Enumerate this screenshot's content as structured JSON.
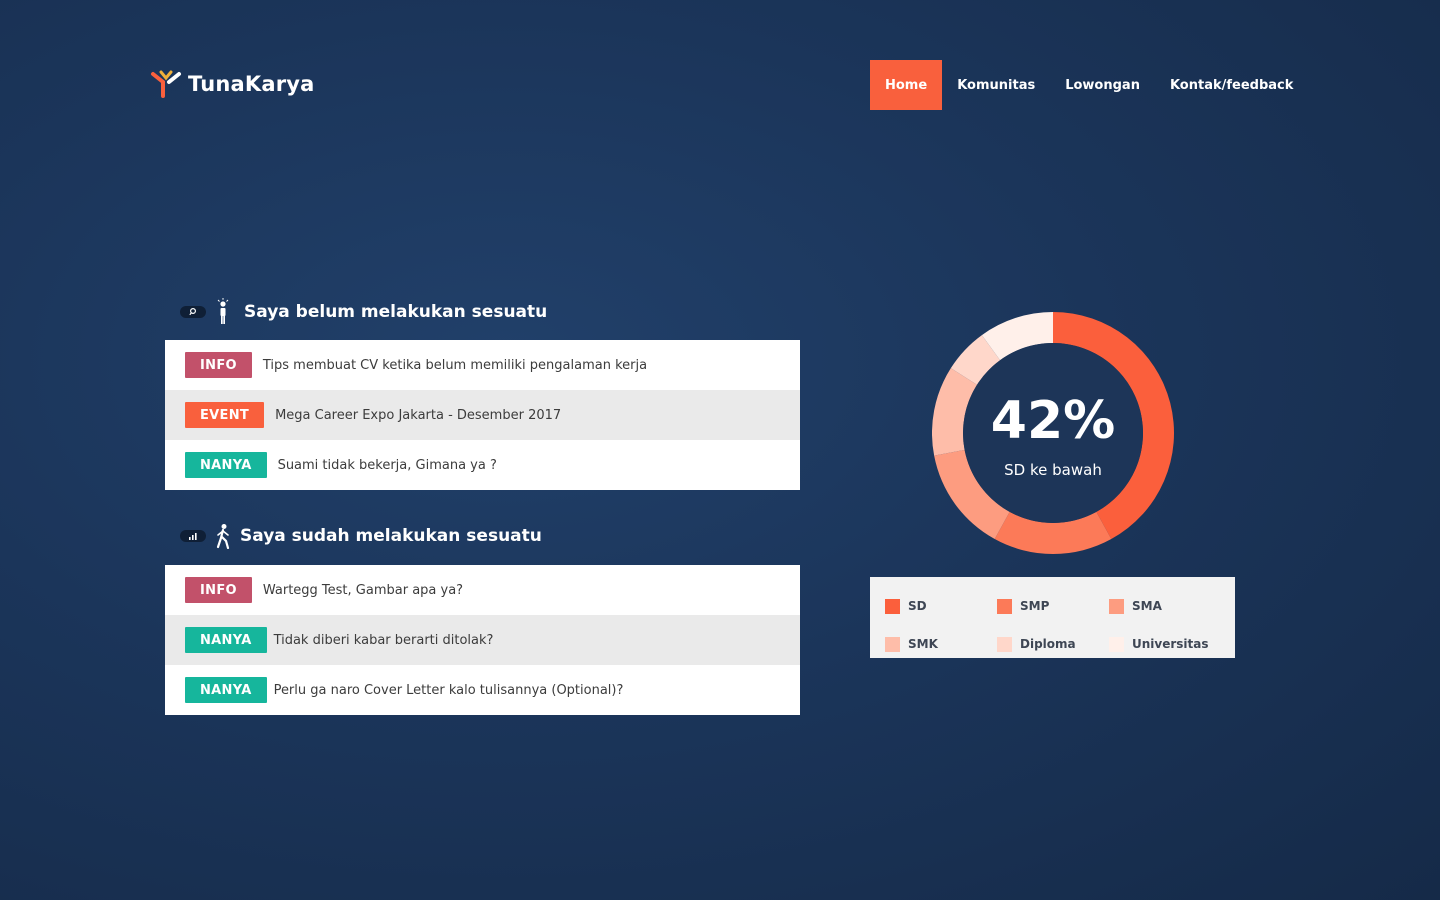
{
  "brand": {
    "name": "TunaKarya"
  },
  "nav": {
    "items": [
      {
        "label": "Home",
        "active": true
      },
      {
        "label": "Komunitas",
        "active": false
      },
      {
        "label": "Lowongan",
        "active": false
      },
      {
        "label": "Kontak/feedback",
        "active": false
      }
    ]
  },
  "section1": {
    "title": "Saya belum melakukan sesuatu",
    "rows": [
      {
        "tag": "INFO",
        "text": "Tips membuat CV ketika belum memiliki pengalaman kerja"
      },
      {
        "tag": "EVENT",
        "text": "Mega Career Expo Jakarta - Desember 2017"
      },
      {
        "tag": "NANYA",
        "text": "Suami tidak bekerja, Gimana ya ?"
      }
    ]
  },
  "section2": {
    "title": "Saya sudah melakukan sesuatu",
    "rows": [
      {
        "tag": "INFO",
        "text": "Wartegg Test, Gambar apa ya?"
      },
      {
        "tag": "NANYA",
        "text": "Tidak diberi kabar berarti ditolak?"
      },
      {
        "tag": "NANYA",
        "text": "Perlu ga naro Cover Letter kalo tulisannya (Optional)?"
      }
    ]
  },
  "donut": {
    "value_label": "42%",
    "caption": "SD ke bawah"
  },
  "chart_data": {
    "type": "pie",
    "categories": [
      "SD",
      "SMP",
      "SMA",
      "SMK",
      "Diploma",
      "Universitas"
    ],
    "values": [
      42,
      16,
      14,
      12,
      6,
      10
    ],
    "colors": [
      "#fb5f3c",
      "#fc7a58",
      "#fd9c80",
      "#febda9",
      "#ffd7ca",
      "#fff0ea"
    ]
  },
  "colors": {
    "accent": "#f9603d",
    "info": "#c2516a",
    "nanya": "#16b69c",
    "donut_center": "#1d3558"
  }
}
